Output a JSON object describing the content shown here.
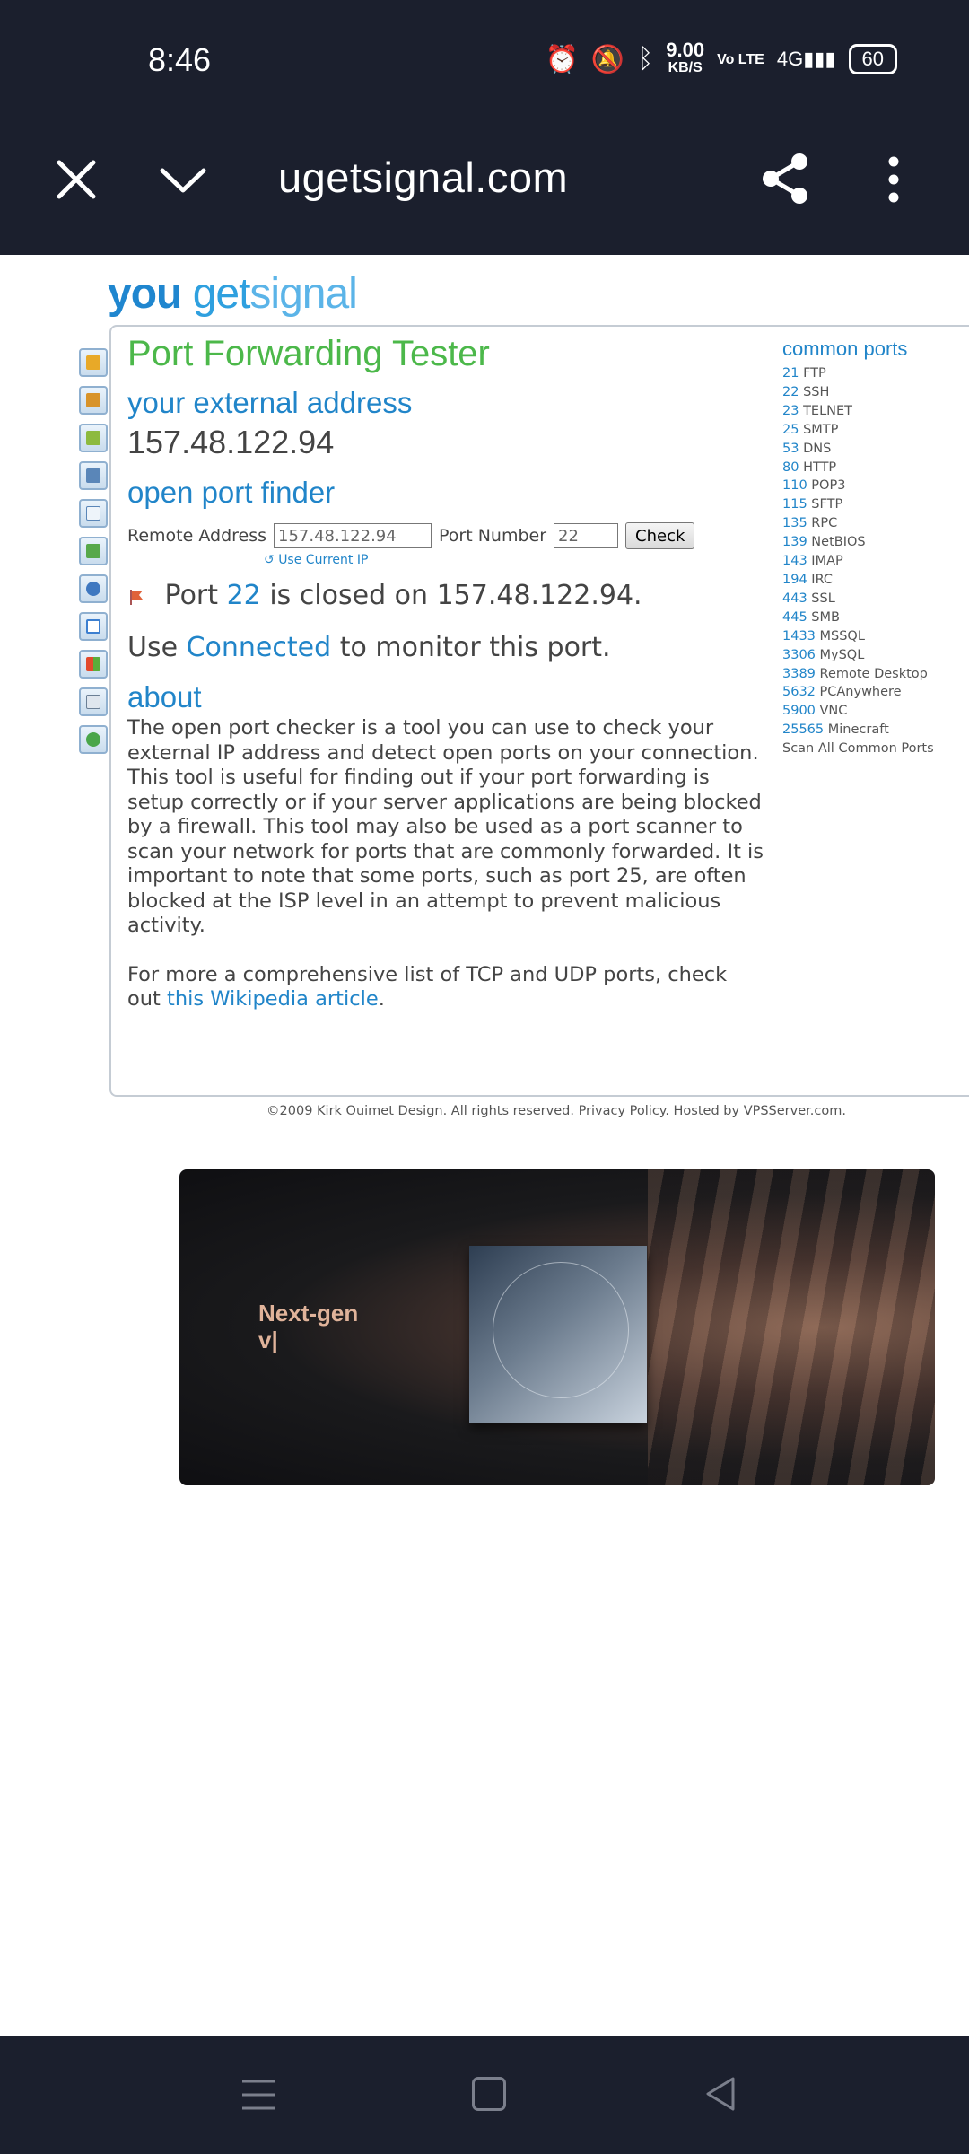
{
  "status_bar": {
    "time": "8:46",
    "net_speed": "9.00",
    "net_speed_unit": "KB/S",
    "volte": "Vo LTE",
    "network": "4G",
    "battery": "60"
  },
  "toolbar": {
    "url": "ugetsignal.com"
  },
  "site": {
    "logo_you": "you",
    "logo_get": "get",
    "logo_signal": "signal"
  },
  "tester": {
    "title": "Port Forwarding Tester",
    "external_heading": "your external address",
    "external_ip": "157.48.122.94",
    "finder_heading": "open port finder",
    "remote_label": "Remote Address",
    "remote_value": "157.48.122.94",
    "port_label": "Port Number",
    "port_value": "22",
    "check_label": "Check",
    "use_current": "Use Current IP",
    "result_prefix": "Port",
    "result_port": "22",
    "result_suffix": "is closed on 157.48.122.94.",
    "monitor_prefix": "Use",
    "monitor_link": "Connected",
    "monitor_suffix": "to monitor this port.",
    "about_heading": "about",
    "about_p1": "The open port checker is a tool you can use to check your external IP address and detect open ports on your connection. This tool is useful for finding out if your port forwarding is setup correctly or if your server applications are being blocked by a firewall. This tool may also be used as a port scanner to scan your network for ports that are commonly forwarded. It is important to note that some ports, such as port 25, are often blocked at the ISP level in an attempt to prevent malicious activity.",
    "about_p2_prefix": "For more a comprehensive list of TCP and UDP ports, check out",
    "about_p2_link": "this Wikipedia article",
    "about_p2_suffix": "."
  },
  "common_ports": {
    "heading": "common ports",
    "items": [
      {
        "port": "21",
        "name": "FTP"
      },
      {
        "port": "22",
        "name": "SSH"
      },
      {
        "port": "23",
        "name": "TELNET"
      },
      {
        "port": "25",
        "name": "SMTP"
      },
      {
        "port": "53",
        "name": "DNS"
      },
      {
        "port": "80",
        "name": "HTTP"
      },
      {
        "port": "110",
        "name": "POP3"
      },
      {
        "port": "115",
        "name": "SFTP"
      },
      {
        "port": "135",
        "name": "RPC"
      },
      {
        "port": "139",
        "name": "NetBIOS"
      },
      {
        "port": "143",
        "name": "IMAP"
      },
      {
        "port": "194",
        "name": "IRC"
      },
      {
        "port": "443",
        "name": "SSL"
      },
      {
        "port": "445",
        "name": "SMB"
      },
      {
        "port": "1433",
        "name": "MSSQL"
      },
      {
        "port": "3306",
        "name": "MySQL"
      },
      {
        "port": "3389",
        "name": "Remote Desktop"
      },
      {
        "port": "5632",
        "name": "PCAnywhere"
      },
      {
        "port": "5900",
        "name": "VNC"
      },
      {
        "port": "25565",
        "name": "Minecraft"
      }
    ],
    "scan_all": "Scan All Common Ports"
  },
  "footer": {
    "copyright": "©2009",
    "author_link": "Kirk Ouimet Design",
    "rights": ". All rights reserved.",
    "privacy_link": "Privacy Policy",
    "hosted": ". Hosted by",
    "host_link": "VPSServer.com",
    "end": "."
  },
  "ad": {
    "line1": "Next-gen",
    "line2": "v|"
  },
  "sidebar_icons": [
    "lock-icon",
    "chart-icon",
    "image-icon",
    "window-icon",
    "mail-icon",
    "network-icon",
    "help-icon",
    "google-icon",
    "windows-icon",
    "document-icon",
    "globe-icon"
  ]
}
